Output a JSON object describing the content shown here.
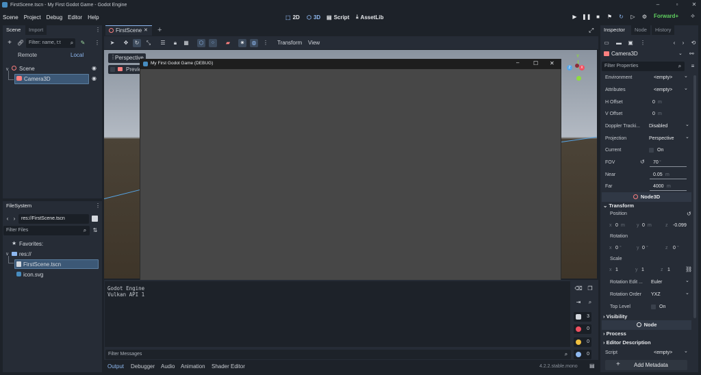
{
  "window": {
    "title": "FirstScene.tscn - My First Godot Game - Godot Engine"
  },
  "menubar": {
    "items": [
      "Scene",
      "Project",
      "Debug",
      "Editor",
      "Help"
    ]
  },
  "workspaces": {
    "w2d": "2D",
    "w3d": "3D",
    "script": "Script",
    "assetlib": "AssetLib"
  },
  "renderer": "Forward+",
  "scene_dock": {
    "tab_scene": "Scene",
    "tab_import": "Import",
    "filter_placeholder": "Filter: name, t:t",
    "remote": "Remote",
    "local": "Local",
    "tree": [
      {
        "label": "Scene",
        "level": 0
      },
      {
        "label": "Camera3D",
        "level": 1,
        "selected": true
      }
    ]
  },
  "filesystem": {
    "tab": "FileSystem",
    "path": "res://FirstScene.tscn",
    "filter_placeholder": "Filter Files",
    "favorites": "Favorites:",
    "root": "res://",
    "files": [
      "FirstScene.tscn",
      "icon.svg"
    ]
  },
  "editor": {
    "tab": "FirstScene",
    "toolbar": {
      "transform": "Transform",
      "view": "View"
    },
    "viewport": {
      "perspective": "Perspective",
      "preview": "Preview"
    }
  },
  "debug_window": {
    "title": "My First Godot Game (DEBUG)"
  },
  "output": {
    "lines": [
      "Godot Engine",
      "Vulkan API 1"
    ],
    "filter_placeholder": "Filter Messages",
    "counts": {
      "messages": "3",
      "errors": "0",
      "warnings": "0",
      "info": "0"
    }
  },
  "bottom_tabs": [
    "Output",
    "Debugger",
    "Audio",
    "Animation",
    "Shader Editor"
  ],
  "version": "4.2.2.stable.mono",
  "inspector": {
    "tabs": [
      "Inspector",
      "Node",
      "History"
    ],
    "object": "Camera3D",
    "filter_placeholder": "Filter Properties",
    "props": [
      {
        "label": "Environment",
        "value": "<empty>"
      },
      {
        "label": "Attributes",
        "value": "<empty>"
      },
      {
        "label": "H Offset",
        "value": "0",
        "unit": "m"
      },
      {
        "label": "V Offset",
        "value": "0",
        "unit": "m"
      },
      {
        "label": "Doppler Tracki...",
        "value": "Disabled"
      },
      {
        "label": "Projection",
        "value": "Perspective"
      },
      {
        "label": "Current",
        "value": "On"
      },
      {
        "label": "FOV",
        "value": "70",
        "unit": "°"
      },
      {
        "label": "Near",
        "value": "0.05",
        "unit": "m"
      },
      {
        "label": "Far",
        "value": "4000",
        "unit": "m"
      }
    ],
    "node3d": "Node3D",
    "transform": "Transform",
    "position": {
      "label": "Position",
      "x": "0",
      "y": "0",
      "z": "-0.099",
      "unit": "m"
    },
    "rotation": {
      "label": "Rotation",
      "x": "0",
      "y": "0",
      "z": "0",
      "unit": "°"
    },
    "scale": {
      "label": "Scale",
      "x": "1",
      "y": "1",
      "z": "1"
    },
    "rotation_edit": {
      "label": "Rotation Edit ...",
      "value": "Euler"
    },
    "rotation_order": {
      "label": "Rotation Order",
      "value": "YXZ"
    },
    "top_level": {
      "label": "Top Level",
      "value": "On"
    },
    "visibility": "Visibility",
    "node": "Node",
    "process": "Process",
    "editor_description": "Editor Description",
    "script": {
      "label": "Script",
      "value": "<empty>"
    },
    "add_metadata": "Add Metadata"
  }
}
